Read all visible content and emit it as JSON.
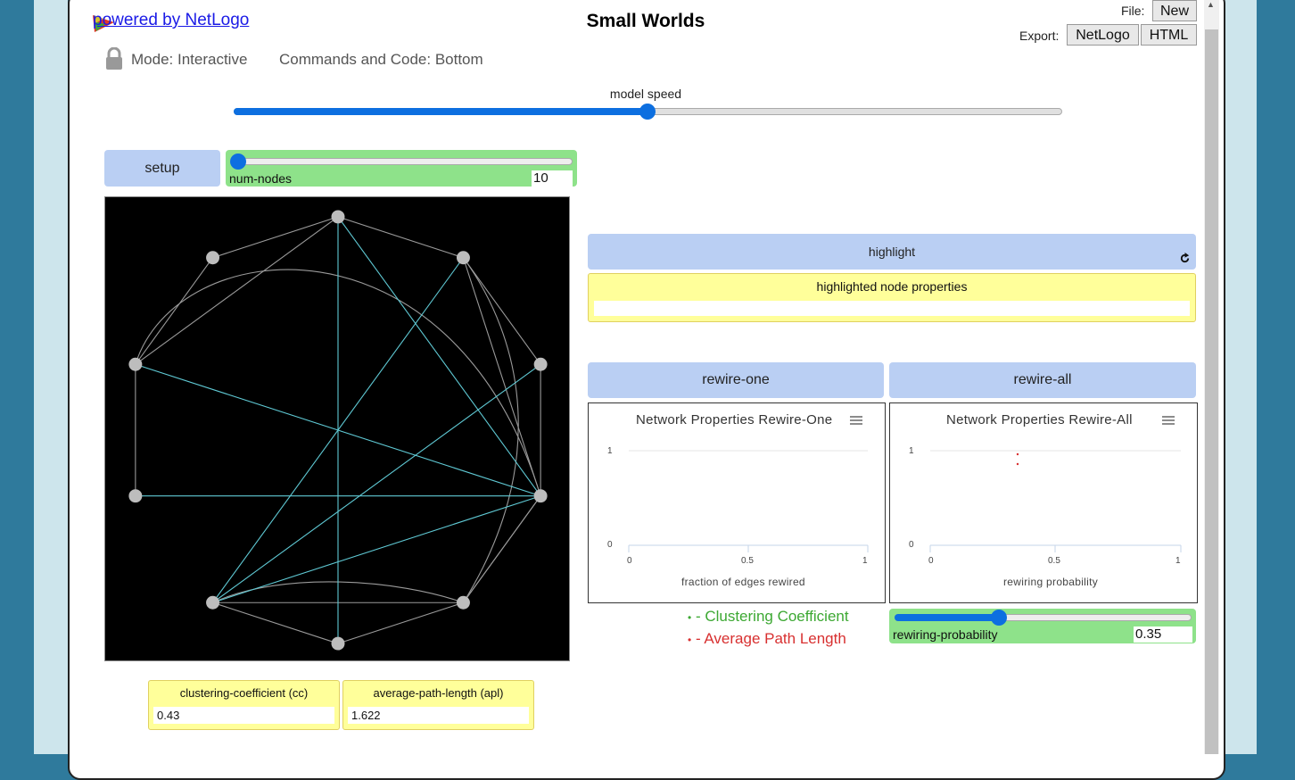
{
  "header": {
    "powered_by": "powered by NetLogo",
    "title": "Small Worlds",
    "file_label": "File:",
    "new_button": "New",
    "export_label": "Export:",
    "export_netlogo": "NetLogo",
    "export_html": "HTML",
    "mode": "Mode: Interactive",
    "commands_and_code": "Commands and Code: Bottom"
  },
  "model_speed": {
    "label": "model speed",
    "value_fraction": 0.5
  },
  "widgets": {
    "setup_button": "setup",
    "num_nodes": {
      "label": "num-nodes",
      "value": "10"
    },
    "highlight_button": "highlight",
    "highlighted_monitor": {
      "label": "highlighted node properties",
      "value": ""
    },
    "rewire_one_button": "rewire-one",
    "rewire_all_button": "rewire-all",
    "rewiring_probability": {
      "label": "rewiring-probability",
      "value": "0.35",
      "value_fraction": 0.35
    },
    "cc_monitor": {
      "label": "clustering-coefficient (cc)",
      "value": "0.43"
    },
    "apl_monitor": {
      "label": "average-path-length (apl)",
      "value": "1.622"
    }
  },
  "plots": [
    {
      "title": "Network Properties Rewire-One",
      "xlabel": "fraction of edges rewired",
      "y_ticks": [
        "1",
        "0"
      ],
      "x_ticks": [
        "0",
        "0.5",
        "1"
      ]
    },
    {
      "title": "Network Properties Rewire-All",
      "xlabel": "rewiring probability",
      "y_ticks": [
        "1",
        "0"
      ],
      "x_ticks": [
        "0",
        "0.5",
        "1"
      ]
    }
  ],
  "legend": {
    "bullet": "•",
    "clustering": "- Clustering Coefficient",
    "path_length": "- Average Path Length",
    "clustering_color": "#3ca832",
    "path_length_color": "#d83030"
  },
  "colors": {
    "button_blue": "#bacff3",
    "slider_green": "#8ee28a",
    "monitor_yellow": "#ffff9a",
    "link_gray": "#9a9a9a",
    "link_cyan": "#5fc9d4",
    "node_gray": "#bdbdbd"
  }
}
